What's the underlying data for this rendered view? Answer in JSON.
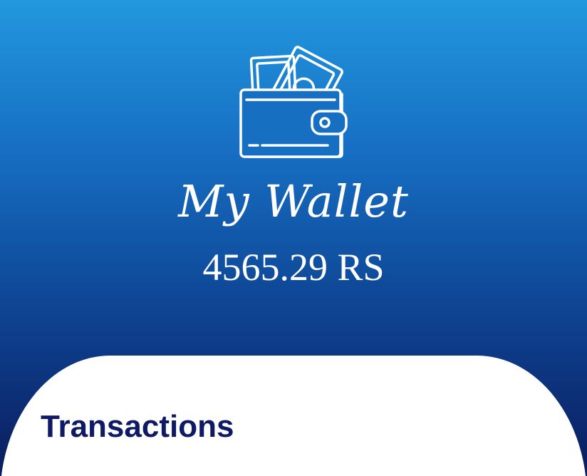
{
  "colors": {
    "gradient_top": "#2298de",
    "gradient_bottom": "#0a1c5e",
    "panel_background": "#ffffff",
    "section_title_color": "#0e1a66"
  },
  "header": {
    "icon": "wallet-icon",
    "title": "My Wallet",
    "balance": "4565.29 RS"
  },
  "transactions": {
    "title": "Transactions"
  }
}
